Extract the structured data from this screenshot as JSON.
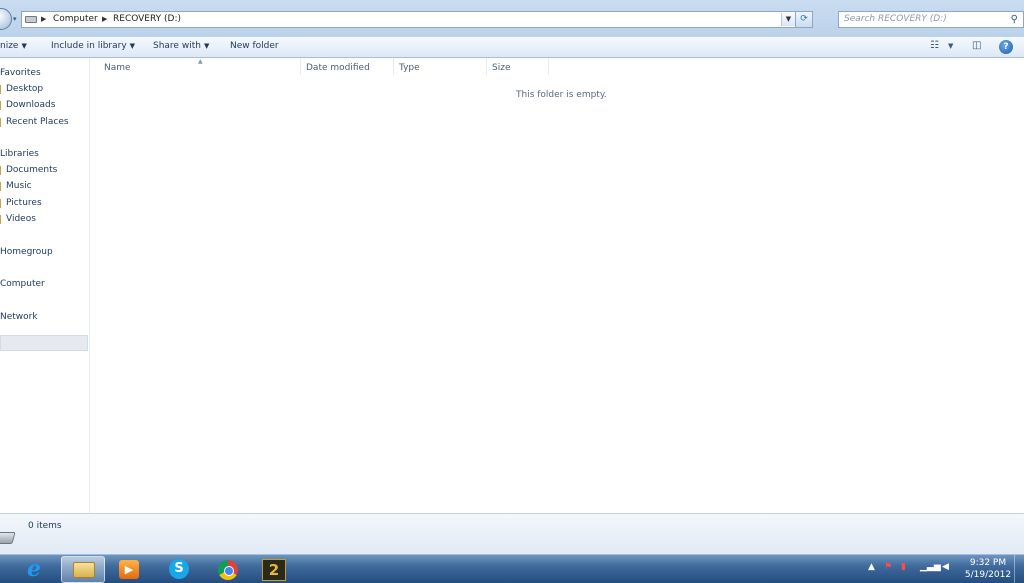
{
  "address_bar": {
    "crumbs": [
      "Computer",
      "RECOVERY (D:)"
    ],
    "search_placeholder": "Search RECOVERY (D:)"
  },
  "toolbar": {
    "organize_label": "nize",
    "include_label": "Include in library",
    "share_label": "Share with",
    "new_folder_label": "New folder",
    "help_label": "?"
  },
  "nav": {
    "favorites": "Favorites",
    "favorites_items": [
      "Desktop",
      "Downloads",
      "Recent Places"
    ],
    "libraries": "Libraries",
    "libraries_items": [
      "Documents",
      "Music",
      "Pictures",
      "Videos"
    ],
    "homegroup": "Homegroup",
    "computer": "Computer",
    "network": "Network"
  },
  "content": {
    "columns": [
      "Name",
      "Date modified",
      "Type",
      "Size"
    ],
    "empty_message": "This folder is empty."
  },
  "details": {
    "item_count": "0 items"
  },
  "taskbar": {
    "skype_glyph": "S",
    "game_glyph": "2",
    "time": "9:32 PM",
    "date": "5/19/2012"
  }
}
